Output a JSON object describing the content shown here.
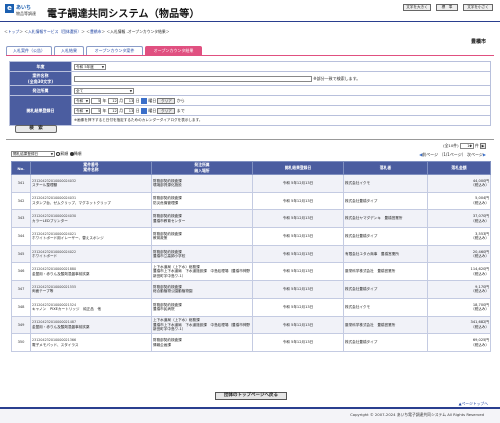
{
  "header": {
    "logo_text": "あいち",
    "logo_sub": "物品等調達",
    "title": "電子調達共同システム（物品等）",
    "font_buttons": [
      "文字を大きく",
      "標　準",
      "文字を小さく"
    ]
  },
  "breadcrumb": {
    "items": [
      "トップ",
      "入札情報サービス（団体選択）",
      "豊橋市",
      "入札情報 -オープンカウンタ結果"
    ],
    "sep": " > "
  },
  "org": "豊橋市",
  "tabs": [
    "入札案件（公告）",
    "入札結果",
    "オープンカウンタ案件",
    "オープンカウンタ結果"
  ],
  "form": {
    "year_label": "年度",
    "year_value": "令和 5年度",
    "case_label": "案件名称\n(全角30文字)",
    "case_note": "※部分一致で検索します。",
    "section_label": "発注所属",
    "section_value": "全て",
    "date_label": "開札結果登録日",
    "from": {
      "era": "令和",
      "y": "5",
      "m": "12",
      "d": "13",
      "day": "曜日"
    },
    "to": {
      "era": "令和",
      "y": "5",
      "m": "12",
      "d": "13",
      "day": "曜日"
    },
    "clear": "クリア",
    "from_suffix": "から",
    "to_suffix": "まで",
    "note": "※画像を押下すると日付を指定するためのカレンダーダイアログを表示します。",
    "search_button": "検　索"
  },
  "sort": {
    "select": "開札結果登録日",
    "asc": "昇順",
    "desc": "降順"
  },
  "pager": {
    "count": "(全10件)",
    "per_page": "10",
    "unit": "件",
    "prev": "前ページ",
    "page_info": "（1/1ページ）",
    "next": "次ページ"
  },
  "columns": [
    "No.",
    "案件番号\n案件名称",
    "発注所属\n納入場所",
    "開札結果登録日",
    "落札者",
    "落札金額"
  ],
  "rows": [
    {
      "no": "341",
      "num": "231204232010000024032",
      "name": "スチール整理棚",
      "dept": "財務部契約検査課",
      "place": "環境部資源化施設",
      "date": "令和 5年12月13日",
      "winner": "株式会社イクモ",
      "amount": "44,000円",
      "tax": "（税込み）"
    },
    {
      "no": "342",
      "num": "231204232010000024031",
      "name": "スタンプ台、ゼムクリップ、マグネットクリップ",
      "dept": "財務部契約検査課",
      "place": "防災危機管理課",
      "date": "令和 5年12月13日",
      "winner": "株式会社豊橋タイプ",
      "amount": "5,004円",
      "tax": "（税込み）"
    },
    {
      "no": "343",
      "num": "231204232010000024030",
      "name": "カラーLEDプリンター",
      "dept": "財務部契約検査課",
      "place": "豊橋市教育センター",
      "date": "令和 5年12月13日",
      "winner": "株式会社ヤマダデンキ　豊橋営業所",
      "amount": "37,070円",
      "tax": "（税込み）"
    },
    {
      "no": "344",
      "num": "231204232010000024021",
      "name": "ホワイトボード用イレーザー、替えスポンジ",
      "dept": "財務部契約検査課",
      "place": "教育政策",
      "date": "令和 5年12月13日",
      "winner": "株式会社豊橋タイプ",
      "amount": "3,553円",
      "tax": "（税込み）"
    },
    {
      "no": "345",
      "num": "231204232010000024022",
      "name": "ホワイトボード",
      "dept": "財務部契約検査課",
      "place": "豊橋市立高師小学校",
      "date": "令和 5年12月13日",
      "winner": "有限会社ユタカ商事　豊橋営業所",
      "amount": "20,460円",
      "tax": "（税込み）"
    },
    {
      "no": "346",
      "num": "231204232010000021880",
      "name": "金盥用・赤りん及酸剤混盤事前試薬",
      "dept": "上下水道局（上下水）総務課",
      "place": "豊橋市上下水道局　下水道施設課　中島処理場（豊橋市神野新田町字中島ワ-1）",
      "date": "令和 5年12月13日",
      "winner": "藤栄科学株式会社　豊橋営業所",
      "amount": "114,620円",
      "tax": "（税込み）"
    },
    {
      "no": "347",
      "num": "231204232010000021555",
      "name": "両面テープ等",
      "dept": "財務部契約検査課",
      "place": "総合動植物公園動植物園",
      "date": "令和 5年12月13日",
      "winner": "株式会社豊橋タイプ",
      "amount": "9,170円",
      "tax": "（税込み）"
    },
    {
      "no": "348",
      "num": "231204232010000021524",
      "name": "キャノン　PIXEカートリッジ　純正品　他",
      "dept": "財務部契約検査課",
      "place": "豊橋市民病院",
      "date": "令和 5年12月13日",
      "winner": "株式会社イクモ",
      "amount": "18,700円",
      "tax": "（税込み）"
    },
    {
      "no": "349",
      "num": "231204232010000021487",
      "name": "金盥用・赤りん及酸剤混盤事前試薬",
      "dept": "上下水道局（上下水）総務課",
      "place": "豊橋市上下水道局　下水道施設課　中島処理場（豊橋市神野新田町字中島ワ-1）",
      "date": "令和 5年12月13日",
      "winner": "藤栄科学株式会社　豊橋営業所",
      "amount": "341,682円",
      "tax": "（税込み）"
    },
    {
      "no": "350",
      "num": "231204232010000021366",
      "name": "電子メモパッド、スタイラス",
      "dept": "財務部契約検査課",
      "place": "情報企画課",
      "date": "令和 5年12月13日",
      "winner": "株式会社豊橋タイプ",
      "amount": "69,025円",
      "tax": "（税込み）"
    }
  ],
  "back_button": "団体のトップページへ戻る",
  "page_top": "▲ページトップへ",
  "copyright": "Copyright © 2007-2024 あいち電子調達共同システム All Rights Reserved"
}
